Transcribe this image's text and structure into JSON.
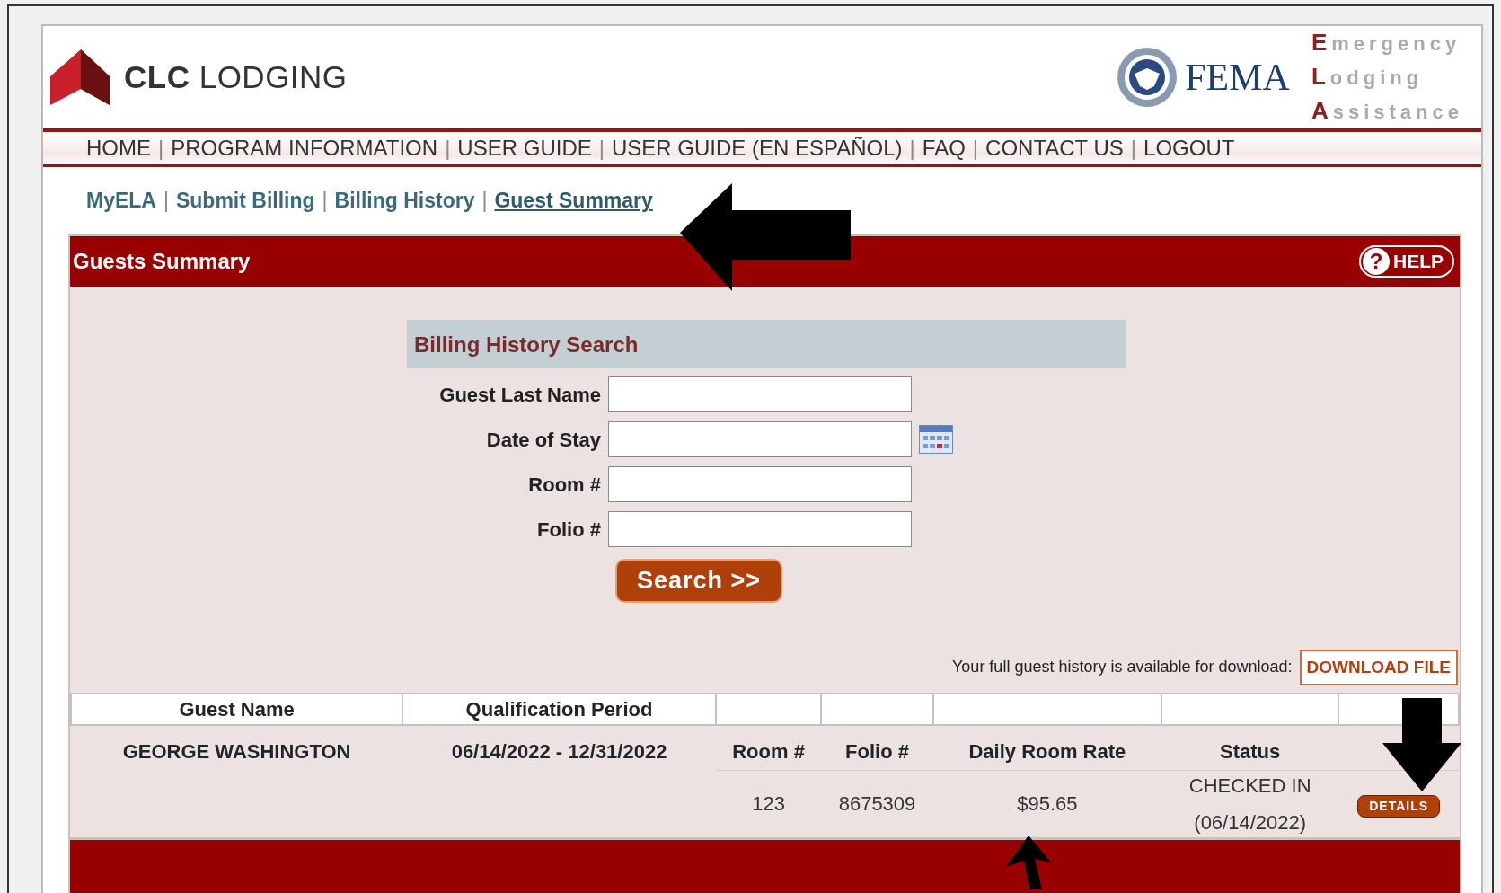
{
  "header": {
    "brand_bold": "CLC",
    "brand_rest": "LODGING",
    "agency": "FEMA",
    "program_lines": [
      "Emergency",
      "Lodging",
      "Assistance"
    ]
  },
  "main_nav": {
    "separator": "|",
    "items": [
      {
        "label": "HOME"
      },
      {
        "label": "PROGRAM INFORMATION"
      },
      {
        "label": "USER GUIDE"
      },
      {
        "label": "USER GUIDE (EN ESPAÑOL)"
      },
      {
        "label": "FAQ"
      },
      {
        "label": "CONTACT US"
      },
      {
        "label": "LOGOUT"
      }
    ]
  },
  "sub_nav": {
    "separator": "|",
    "items": [
      {
        "label": "MyELA",
        "selected": false
      },
      {
        "label": "Submit Billing",
        "selected": false
      },
      {
        "label": "Billing History",
        "selected": false
      },
      {
        "label": "Guest Summary",
        "selected": true
      }
    ],
    "pointer_arrow": {
      "kind": "left"
    }
  },
  "panel": {
    "title": "Guests Summary",
    "help_button": "HELP",
    "help_glyph": "?"
  },
  "search": {
    "title": "Billing History Search",
    "fields": [
      {
        "label": "Guest Last Name",
        "kind": "text"
      },
      {
        "label": "Date of Stay",
        "kind": "date"
      },
      {
        "label": "Room #",
        "kind": "text"
      },
      {
        "label": "Folio #",
        "kind": "text"
      }
    ],
    "button": "Search >>"
  },
  "download": {
    "text": "Your full guest history is available for download:",
    "button": "DOWNLOAD FILE"
  },
  "table": {
    "columns": [
      "Guest Name",
      "Qualification Period"
    ],
    "pointer_arrow": {
      "kind": "down"
    },
    "rows": [
      {
        "guest_name": "GEORGE WASHINGTON",
        "qualification_period": "06/14/2022 - 12/31/2022",
        "sub_columns": [
          "Room #",
          "Folio #",
          "Daily Room Rate",
          "Status"
        ],
        "stays": [
          {
            "room": "123",
            "folio": "8675309",
            "rate": "$95.65",
            "status": "CHECKED IN",
            "status_date": "(06/14/2022)",
            "action": "DETAILS"
          }
        ]
      }
    ]
  },
  "footer": {
    "pointer_arrow": {
      "kind": "up"
    }
  }
}
